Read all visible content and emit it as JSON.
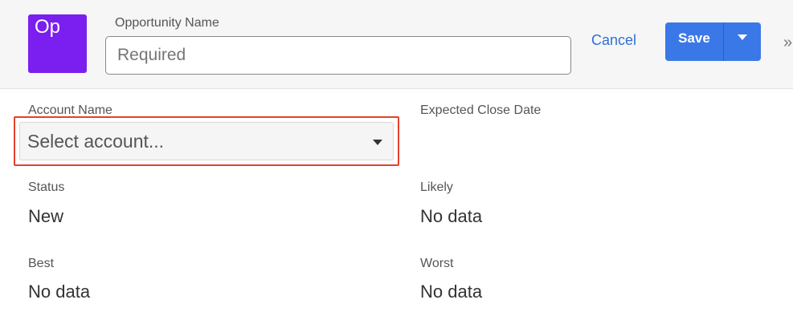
{
  "header": {
    "avatar_text": "Op",
    "avatar_color": "#7a1ff0",
    "opportunity_name_label": "Opportunity Name",
    "opportunity_name_value": "Required",
    "cancel_label": "Cancel",
    "save_label": "Save",
    "more_icon": "»"
  },
  "fields": {
    "account_name": {
      "label": "Account Name",
      "placeholder": "Select account..."
    },
    "expected_close_date": {
      "label": "Expected Close Date",
      "value": ""
    },
    "status": {
      "label": "Status",
      "value": "New"
    },
    "likely": {
      "label": "Likely",
      "value": "No data"
    },
    "best": {
      "label": "Best",
      "value": "No data"
    },
    "worst": {
      "label": "Worst",
      "value": "No data"
    }
  },
  "colors": {
    "accent": "#3b78e7",
    "link": "#2f6fd8",
    "highlight": "#e4402c"
  }
}
